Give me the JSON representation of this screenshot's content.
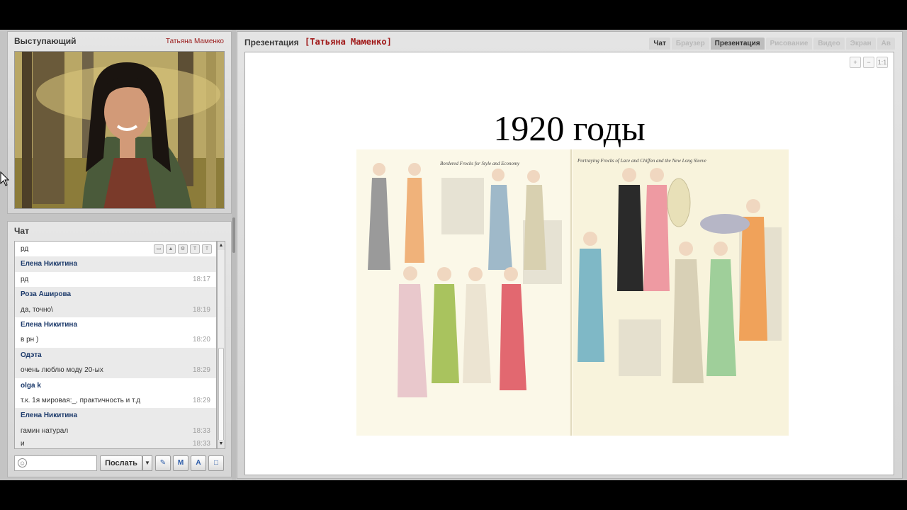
{
  "speaker": {
    "title": "Выступающий",
    "name": "Татьяна Маменко"
  },
  "chat": {
    "title": "Чат",
    "messages": [
      {
        "type": "text",
        "text": "рд",
        "time": ""
      },
      {
        "type": "author",
        "text": "Елена Никитина"
      },
      {
        "type": "text",
        "text": "рд",
        "time": "18:17"
      },
      {
        "type": "author",
        "text": "Роза Аширова"
      },
      {
        "type": "text",
        "text": "да, точно\\",
        "time": "18:19"
      },
      {
        "type": "author",
        "text": "Елена Никитина"
      },
      {
        "type": "text",
        "text": "в рн )",
        "time": "18:20"
      },
      {
        "type": "author",
        "text": "Одэта"
      },
      {
        "type": "text",
        "text": "очень люблю моду 20-ых",
        "time": "18:29"
      },
      {
        "type": "author",
        "text": "olga k"
      },
      {
        "type": "text",
        "text": "т.к. 1я мировая:_, практичность и т.д",
        "time": "18:29"
      },
      {
        "type": "author",
        "text": "Елена Никитина"
      },
      {
        "type": "text",
        "text": "гамин натурал",
        "time": "18:33"
      },
      {
        "type": "text",
        "text": "и",
        "time": "18:33"
      }
    ],
    "input_value": "",
    "send_label": "Послать"
  },
  "presentation": {
    "title": "Презентация",
    "presenter": "[Татьяна Маменко]",
    "tabs": [
      {
        "label": "Чат",
        "state": "enabled"
      },
      {
        "label": "Браузер",
        "state": "disabled"
      },
      {
        "label": "Презентация",
        "state": "active"
      },
      {
        "label": "Рисование",
        "state": "disabled"
      },
      {
        "label": "Видео",
        "state": "disabled"
      },
      {
        "label": "Экран",
        "state": "disabled"
      },
      {
        "label": "Ав",
        "state": "disabled"
      }
    ],
    "slide_heading": "1920 годы",
    "catalog_left_caption": "Bordered Frocks for Style and Economy",
    "catalog_right_caption": "Portraying Frocks of Lace and Chiffon and the New Long Sleeve"
  },
  "colors": {
    "presenter_name": "#a01818",
    "chat_author": "#1c3a6b",
    "panel_bg": "#dcdcdc"
  }
}
